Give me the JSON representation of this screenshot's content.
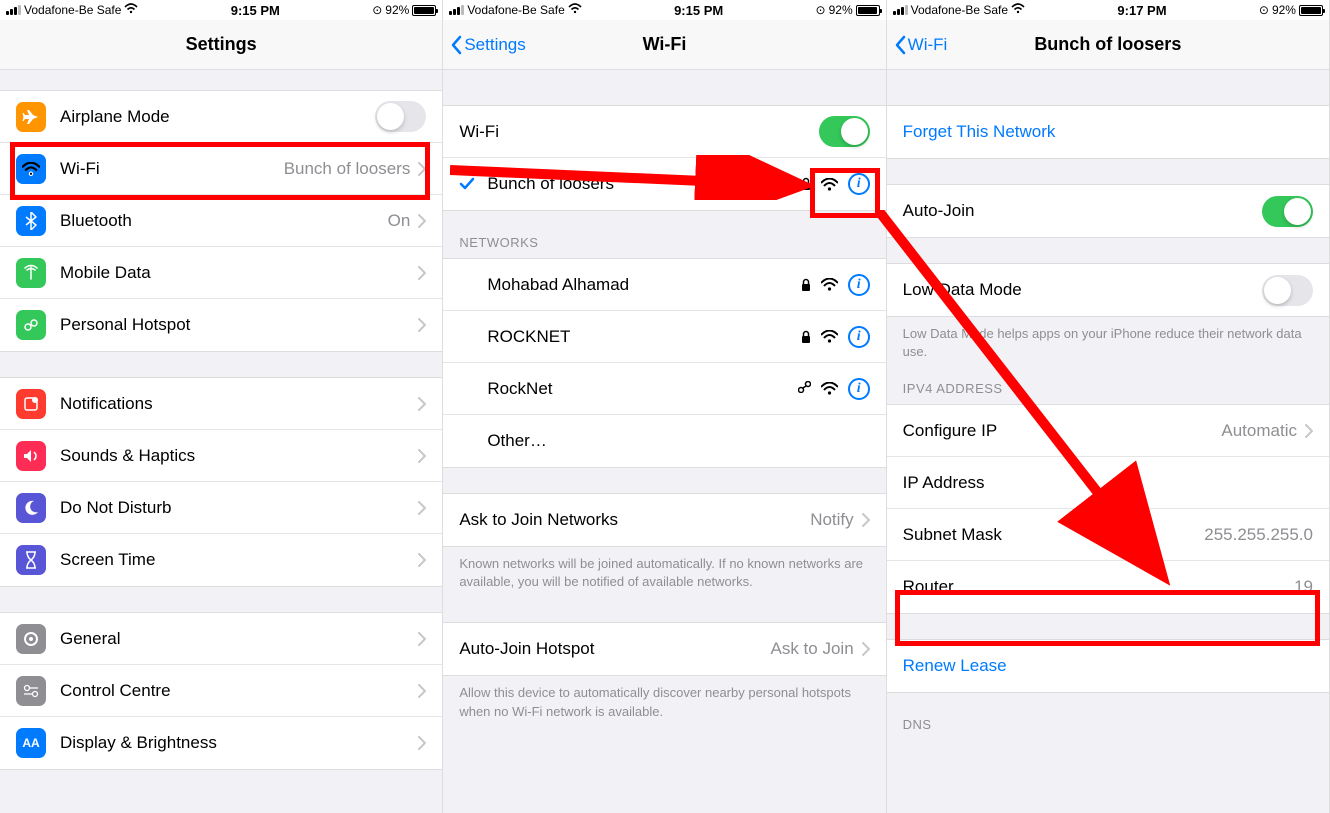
{
  "panel1": {
    "status": {
      "carrier": "Vodafone-Be Safe",
      "time": "9:15 PM",
      "battery": "92%"
    },
    "title": "Settings",
    "rows": {
      "airplane": "Airplane Mode",
      "wifi": "Wi-Fi",
      "wifi_value": "Bunch of loosers",
      "bluetooth": "Bluetooth",
      "bluetooth_value": "On",
      "mobile": "Mobile Data",
      "hotspot": "Personal Hotspot",
      "notifications": "Notifications",
      "sounds": "Sounds & Haptics",
      "dnd": "Do Not Disturb",
      "screentime": "Screen Time",
      "general": "General",
      "control": "Control Centre",
      "display": "Display & Brightness"
    }
  },
  "panel2": {
    "status": {
      "carrier": "Vodafone-Be Safe",
      "time": "9:15 PM",
      "battery": "92%"
    },
    "back": "Settings",
    "title": "Wi-Fi",
    "wifi_toggle_label": "Wi-Fi",
    "connected": "Bunch of loosers",
    "networks_header": "NETWORKS",
    "networks": [
      "Mohabad Alhamad",
      "ROCKNET",
      "RockNet"
    ],
    "other": "Other…",
    "ask_label": "Ask to Join Networks",
    "ask_value": "Notify",
    "ask_footer": "Known networks will be joined automatically. If no known networks are available, you will be notified of available networks.",
    "auto_label": "Auto-Join Hotspot",
    "auto_value": "Ask to Join",
    "auto_footer": "Allow this device to automatically discover nearby personal hotspots when no Wi-Fi network is available."
  },
  "panel3": {
    "status": {
      "carrier": "Vodafone-Be Safe",
      "time": "9:17 PM",
      "battery": "92%"
    },
    "back": "Wi-Fi",
    "title": "Bunch of loosers",
    "forget": "Forget This Network",
    "autojoin": "Auto-Join",
    "lowdata": "Low Data Mode",
    "lowdata_footer": "Low Data Mode helps apps on your iPhone reduce their network data use.",
    "ipv4_header": "IPV4 ADDRESS",
    "configure": "Configure IP",
    "configure_value": "Automatic",
    "ip": "IP Address",
    "subnet": "Subnet Mask",
    "subnet_value": "255.255.255.0",
    "router": "Router",
    "router_value": "19",
    "renew": "Renew Lease",
    "dns_header": "DNS"
  }
}
